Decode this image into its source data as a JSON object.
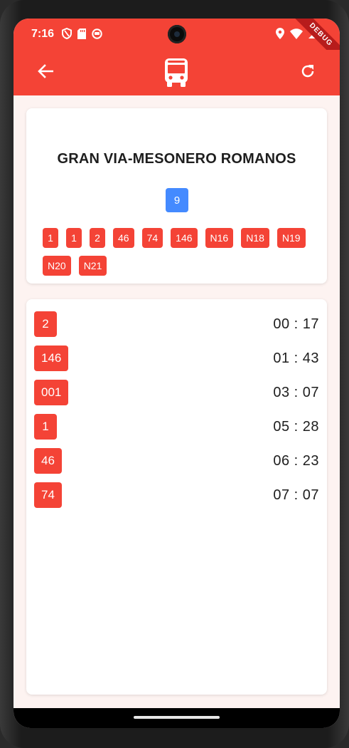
{
  "status": {
    "time": "7:16",
    "left_icons": [
      "shield-icon",
      "sd-card-icon",
      "app-notification-icon"
    ],
    "right_icons": [
      "location-icon",
      "wifi-icon",
      "signal-icon"
    ]
  },
  "debug_banner": "DEBUG",
  "appbar": {
    "back_icon": "arrow-back-icon",
    "logo_icon": "bus-icon",
    "refresh_icon": "refresh-icon"
  },
  "stop": {
    "name": "GRAN VIA-MESONERO ROMANOS",
    "id": "9",
    "lines": [
      "1",
      "1",
      "2",
      "46",
      "74",
      "146",
      "N16",
      "N18",
      "N19",
      "N20",
      "N21"
    ]
  },
  "arrivals": [
    {
      "line": "2",
      "time": "00 : 17"
    },
    {
      "line": "146",
      "time": "01 : 43"
    },
    {
      "line": "001",
      "time": "03 : 07"
    },
    {
      "line": "1",
      "time": "05 : 28"
    },
    {
      "line": "46",
      "time": "06 : 23"
    },
    {
      "line": "74",
      "time": "07 : 07"
    }
  ],
  "colors": {
    "primary": "#f44336",
    "stop_id_badge": "#448aff",
    "background": "#fdf3f1"
  }
}
